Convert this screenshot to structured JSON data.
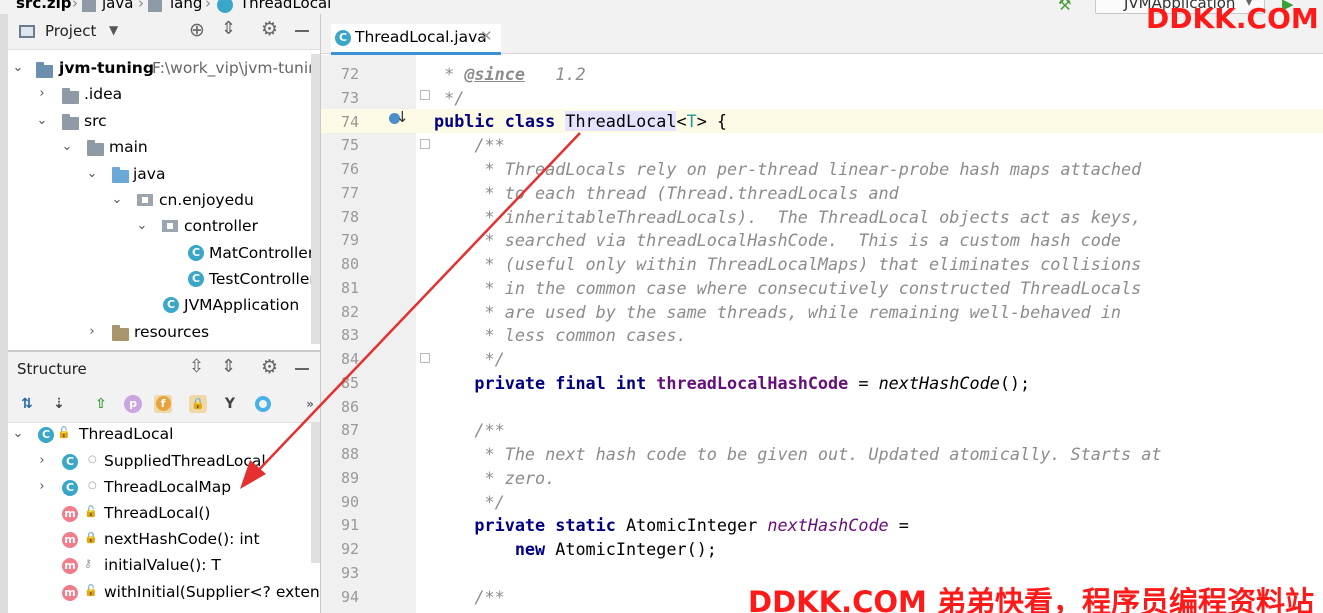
{
  "breadcrumb": {
    "items": [
      "src.zip",
      "java",
      "lang",
      "ThreadLocal"
    ],
    "run_config": "JVMApplication"
  },
  "watermark": {
    "top": "DDKK.COM",
    "bottom": "DDKK.COM 弟弟快看，程序员编程资料站"
  },
  "project_panel": {
    "title": "Project",
    "tree": [
      {
        "label": "jvm-tuning",
        "path": "F:\\work_vip\\jvm-tuning"
      },
      {
        "label": ".idea"
      },
      {
        "label": "src"
      },
      {
        "label": "main"
      },
      {
        "label": "java"
      },
      {
        "label": "cn.enjoyedu"
      },
      {
        "label": "controller"
      },
      {
        "label": "MatController"
      },
      {
        "label": "TestController"
      },
      {
        "label": "JVMApplication"
      },
      {
        "label": "resources"
      }
    ]
  },
  "structure_panel": {
    "title": "Structure",
    "items": [
      {
        "label": "ThreadLocal"
      },
      {
        "label": "SuppliedThreadLocal"
      },
      {
        "label": "ThreadLocalMap"
      },
      {
        "label": "ThreadLocal()"
      },
      {
        "label": "nextHashCode(): int"
      },
      {
        "label": "initialValue(): T"
      },
      {
        "label": "withInitial(Supplier<? extends"
      }
    ]
  },
  "editor": {
    "tab_label": "ThreadLocal.java",
    "line_numbers": [
      "72",
      "73",
      "74",
      "75",
      "76",
      "77",
      "78",
      "79",
      "80",
      "81",
      "82",
      "83",
      "84",
      "85",
      "86",
      "87",
      "88",
      "89",
      "90",
      "91",
      "92",
      "93",
      "94"
    ],
    "lines": {
      "l72a": " * ",
      "l72b": "@since",
      "l72c": "   1.2",
      "l73": " */",
      "l74a": "public class ",
      "l74b": "ThreadLocal",
      "l74c": "<",
      "l74d": "T",
      "l74e": "> {",
      "l75": "    /**",
      "l76": "     * ThreadLocals rely on per-thread linear-probe hash maps attached",
      "l77": "     * to each thread (Thread.threadLocals and",
      "l78": "     * inheritableThreadLocals).  The ThreadLocal objects act as keys,",
      "l79": "     * searched via threadLocalHashCode.  This is a custom hash code",
      "l80": "     * (useful only within ThreadLocalMaps) that eliminates collisions",
      "l81": "     * in the common case where consecutively constructed ThreadLocals",
      "l82": "     * are used by the same threads, while remaining well-behaved in",
      "l83": "     * less common cases.",
      "l84": "     */",
      "l85a": "    private final int ",
      "l85b": "threadLocalHashCode",
      "l85c": " = ",
      "l85d": "nextHashCode",
      "l85e": "();",
      "l87": "    /**",
      "l88": "     * The next hash code to be given out. Updated atomically. Starts at",
      "l89": "     * zero.",
      "l90": "     */",
      "l91a": "    private static ",
      "l91b": "AtomicInteger ",
      "l91c": "nextHashCode",
      "l91d": " =",
      "l92a": "        new ",
      "l92b": "AtomicInteger();",
      "l94": "    /**"
    }
  },
  "colors": {
    "annotation_arrow": "#e53030",
    "keyword": "#000080",
    "comment": "#8c8c8c",
    "field": "#660e7a",
    "tab_accent": "#3d8fd6"
  }
}
